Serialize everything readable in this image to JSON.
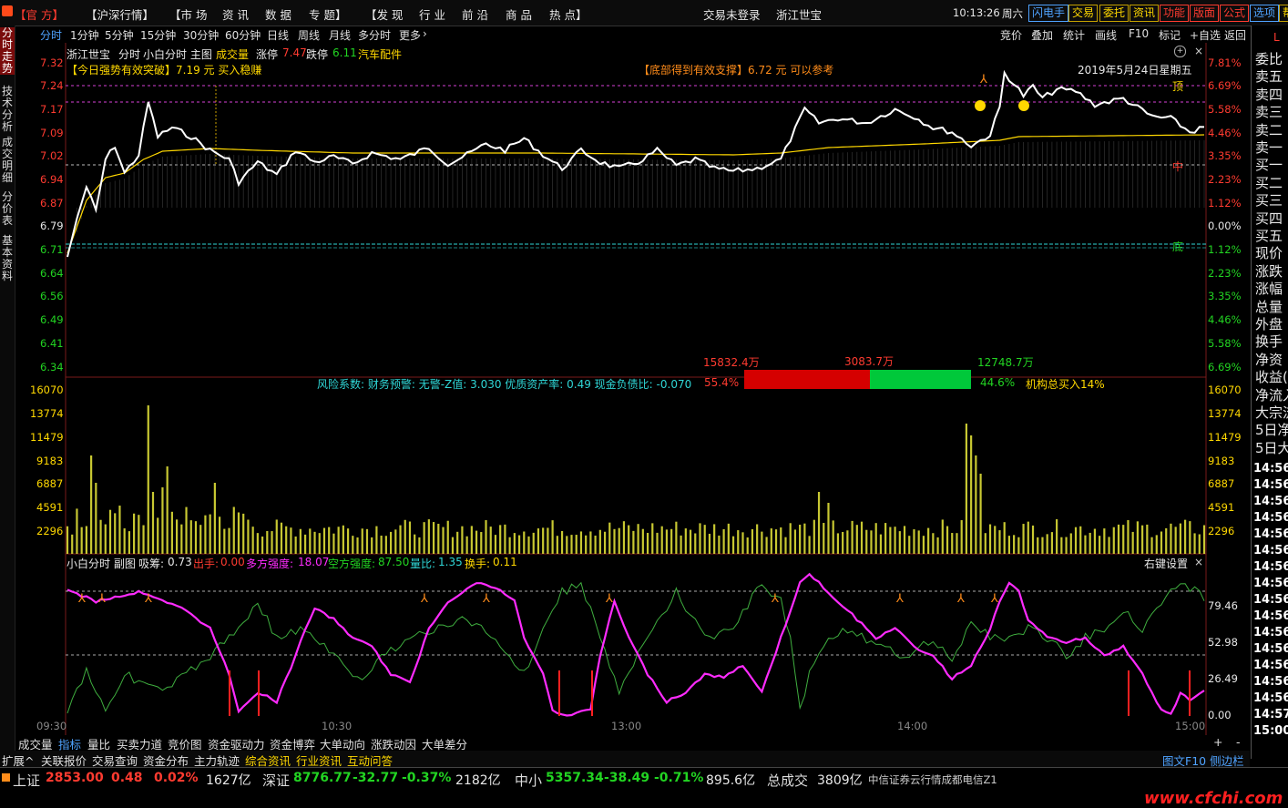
{
  "top_menu": {
    "items": [
      "【官 方】",
      "【沪深行情】",
      "【市 场",
      "资 讯",
      "数 据",
      "专 题】",
      "【发 现",
      "行 业",
      "前 沿",
      "商 品",
      "热 点】"
    ],
    "login": "交易未登录",
    "stock": "浙江世宝",
    "time": "10:13:26",
    "weekday": "周六",
    "buttons": [
      "闪电手",
      "交易",
      "委托",
      "资讯",
      "功能",
      "版面",
      "公式",
      "选项",
      "帮"
    ]
  },
  "left_tabs": [
    "分时走势",
    "技术分析",
    "成交明细",
    "分价表",
    "基本资料"
  ],
  "period_bar": {
    "items": [
      "分时",
      "1分钟",
      "5分钟",
      "15分钟",
      "30分钟",
      "60分钟",
      "日线",
      "周线",
      "月线",
      "多分时",
      "更多"
    ],
    "right_items": [
      "竞价",
      "叠加",
      "统计",
      "画线",
      "F10",
      "标记",
      "+自选",
      "返回"
    ]
  },
  "chart_header": {
    "name": "浙江世宝",
    "mode": "分时",
    "main_fig": "小白分时 主图",
    "vol_label": "成交量",
    "limit_up_label": "涨停",
    "limit_up": "7.47",
    "limit_down_label": "跌停",
    "limit_down": "6.11",
    "industry": "汽车配件",
    "signal_left": "【今日强势有效突破】7.19 元 买入稳赚",
    "signal_mid": "【底部得到有效支撑】6.72 元 可以参考",
    "date": "2019年5月24日星期五",
    "top_label": "顶",
    "mid_label": "中",
    "bottom_label": "底"
  },
  "price_axis": {
    "left": [
      "7.32",
      "7.24",
      "7.17",
      "7.09",
      "7.02",
      "6.94",
      "6.87",
      "6.79",
      "6.71",
      "6.64",
      "6.56",
      "6.49",
      "6.41",
      "6.34"
    ],
    "right": [
      "7.81%",
      "6.69%",
      "5.58%",
      "4.46%",
      "3.35%",
      "2.23%",
      "1.12%",
      "0.00%",
      "1.12%",
      "2.23%",
      "3.35%",
      "4.46%",
      "5.58%",
      "6.69%"
    ]
  },
  "risk_text": "风险系数: 财务预警: 无警-Z值: 3.030 优质资产率: 0.49 现金负债比: -0.070",
  "fund_flow": {
    "sell_amount": "15832.4万",
    "mid_amount": "3083.7万",
    "buy_amount": "12748.7万",
    "sell_pct": "55.4%",
    "buy_pct": "44.6%",
    "sell_ratio": 0.554,
    "note": "机构总买入14%"
  },
  "volume_axis": [
    "16070",
    "13774",
    "11479",
    "9183",
    "6887",
    "4591",
    "2296"
  ],
  "sub_header": {
    "title": "小白分时 副图",
    "items": [
      {
        "label": "吸筹:",
        "value": "0.73"
      },
      {
        "label": "出手:",
        "value": "0.00"
      },
      {
        "label": "多方强度:",
        "value": "18.07"
      },
      {
        "label": "空方强度:",
        "value": "87.50"
      },
      {
        "label": "量比:",
        "value": "1.35"
      },
      {
        "label": "换手:",
        "value": "0.11"
      }
    ],
    "settings": "右键设置"
  },
  "sub_axis": [
    "79.46",
    "52.98",
    "26.49",
    "0.00"
  ],
  "time_axis": [
    "09:30",
    "10:30",
    "13:00",
    "14:00",
    "15:00"
  ],
  "right_panel": {
    "labels": [
      "委比",
      "卖五",
      "卖四",
      "卖三",
      "卖二",
      "卖一",
      "买一",
      "买二",
      "买三",
      "买四",
      "买五",
      "现价",
      "涨跌",
      "涨幅",
      "总量",
      "外盘",
      "换手",
      "净资",
      "收益(",
      "净流入",
      "大宗流",
      "5日净",
      "5日大"
    ],
    "times": [
      "14:56",
      "14:56",
      "14:56",
      "14:56",
      "14:56",
      "14:56",
      "14:56",
      "14:56",
      "14:56",
      "14:56",
      "14:56",
      "14:56",
      "14:56",
      "14:56",
      "14:56",
      "14:57",
      "15:00"
    ],
    "corner": "L"
  },
  "bottom_tabs": [
    "成交量",
    "指标",
    "量比",
    "买卖力道",
    "竞价图",
    "资金驱动力",
    "资金博弈",
    "大单动向",
    "涨跌动因",
    "大单差分"
  ],
  "bottom_tab_controls": [
    "+",
    "-"
  ],
  "ext_bar": {
    "items": [
      "扩展^",
      "关联报价",
      "交易查询",
      "资金分布",
      "主力轨迹",
      "综合资讯",
      "行业资讯",
      "互动问答"
    ],
    "right": "图文F10 侧边栏《 笔"
  },
  "status_bar": {
    "sh_label": "上证",
    "sh_val": "2853.00",
    "sh_chg": "0.48",
    "sh_pct": "0.02%",
    "sh_amt": "1627亿",
    "sz_label": "深证",
    "sz_val": "8776.77",
    "sz_chg": "-32.77",
    "sz_pct": "-0.37%",
    "sz_amt": "2182亿",
    "zx_label": "中小",
    "zx_val": "5357.34",
    "zx_chg": "-38.49",
    "zx_pct": "-0.71%",
    "zx_amt": "895.6亿",
    "total_label": "总成交",
    "total_amt": "3809亿",
    "broker": "中信证券云行情成都电信Z1"
  },
  "watermark": "www.cfchi.com",
  "colors": {
    "up": "#ff3b30",
    "down": "#22d422",
    "price_line": "#ffffff",
    "avg_line": "#ffd800",
    "strength": "#ff2bff",
    "weak": "#3fae3f",
    "volume": "#c8c832"
  }
}
